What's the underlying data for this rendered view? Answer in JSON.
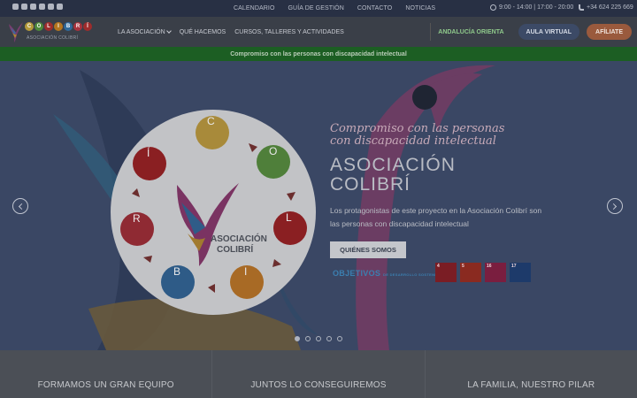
{
  "topbar": {
    "social_icons": [
      "telegram-icon",
      "facebook-icon",
      "instagram-icon",
      "twitter-icon",
      "email-icon",
      "youtube-icon"
    ],
    "links": [
      "CALENDARIO",
      "GUÍA DE GESTIÓN",
      "CONTACTO",
      "NOTICIAS"
    ],
    "hours": "9:00 - 14:00 | 17:00 - 20:00",
    "phone": "+34 624 225 669"
  },
  "header": {
    "logo_letters": [
      "C",
      "O",
      "L",
      "I",
      "B",
      "R",
      "Í"
    ],
    "logo_sub": "ASOCIACIÓN COLIBRÍ",
    "nav": [
      "LA ASOCIACIÓN",
      "QUÉ HACEMOS",
      "CURSOS, TALLERES Y ACTIVIDADES"
    ],
    "andalucia": "ANDALUCÍA ORIENTA",
    "aula": "AULA VIRTUAL",
    "afiliate": "AFÍLIATE"
  },
  "banner": "Compromiso con las personas con discapacidad intelectual",
  "hero": {
    "script_title": "Compromiso con las personas con discapacidad intelectual",
    "title_line1": "ASOCIACIÓN",
    "title_line2": "COLIBRÍ",
    "text": "Los protagonistas de este proyecto en la Asociación Colibrí son las personas con discapacidad intelectual",
    "button": "QUIÉNES SOMOS",
    "ods_label": "OBJETIVOS",
    "ods_label_small": "DE DESARROLLO SOSTENIBLE",
    "ods": [
      "4",
      "5",
      "16",
      "17"
    ],
    "circle_letters": [
      "C",
      "O",
      "L",
      "I",
      "B",
      "R",
      "Í"
    ],
    "circle_logo_line1": "ASOCIACIÓN",
    "circle_logo_line2": "COLIBRÍ",
    "slides": 5,
    "active_slide": 1
  },
  "bottom": [
    "FORMAMOS UN GRAN EQUIPO",
    "JUNTOS LO CONSEGUIREMOS",
    "LA FAMILIA, NUESTRO PILAR"
  ],
  "colors": {
    "topbar": "#283044",
    "header": "#3a3f48",
    "banner": "#1c5e23",
    "hero": "#3a4764",
    "afiliate": "#9a5a3d",
    "aula": "#3c4a66"
  }
}
